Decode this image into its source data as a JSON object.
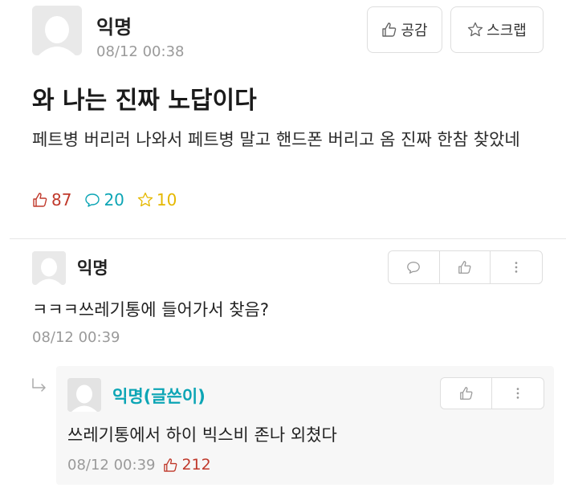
{
  "post": {
    "author": "익명",
    "time": "08/12 00:38",
    "title": "와 나는 진짜 노답이다",
    "body": "페트병 버리러 나와서 페트병 말고 핸드폰 버리고 옴 진짜 한참 찾았네",
    "buttons": {
      "like_label": "공감",
      "scrap_label": "스크랩"
    },
    "stats": {
      "likes": "87",
      "comments": "20",
      "scraps": "10"
    }
  },
  "comments": [
    {
      "author": "익명",
      "text": "ㅋㅋㅋ쓰레기통에 들어가서 찾음?",
      "time": "08/12 00:39",
      "reply": {
        "author": "익명(글쓴이)",
        "text": "쓰레기통에서 하이 빅스비 존나 외쳤다",
        "time": "08/12 00:39",
        "likes": "212"
      }
    }
  ],
  "colors": {
    "like": "#c0392b",
    "comment": "#0ca5b5",
    "scrap": "#e5b800",
    "author_accent": "#0ca5b5"
  },
  "icons": [
    "avatar-icon",
    "thumbs-up-icon",
    "star-icon",
    "comment-icon",
    "more-icon",
    "reply-arrow-icon"
  ]
}
